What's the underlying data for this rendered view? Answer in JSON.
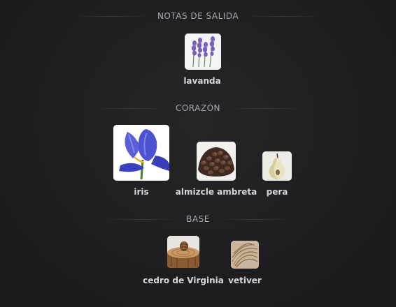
{
  "sections": {
    "top": {
      "title": "NOTAS DE SALIDA"
    },
    "heart": {
      "title": "CORAZÓN"
    },
    "base": {
      "title": "BASE"
    }
  },
  "notes": {
    "lavanda": {
      "label": "lavanda",
      "icon": "lavender-icon"
    },
    "iris": {
      "label": "iris",
      "icon": "iris-flower-icon"
    },
    "almizcle": {
      "label": "almizcle ambreta",
      "icon": "ambrette-seeds-icon"
    },
    "pera": {
      "label": "pera",
      "icon": "pear-icon"
    },
    "cedro": {
      "label": "cedro de Virginia",
      "icon": "cedar-wood-icon"
    },
    "vetiver": {
      "label": "vetiver",
      "icon": "vetiver-root-icon"
    }
  },
  "colors": {
    "background": "#1d1d1f",
    "header_text": "#a8a8ad",
    "label_text": "#d6d6da"
  }
}
